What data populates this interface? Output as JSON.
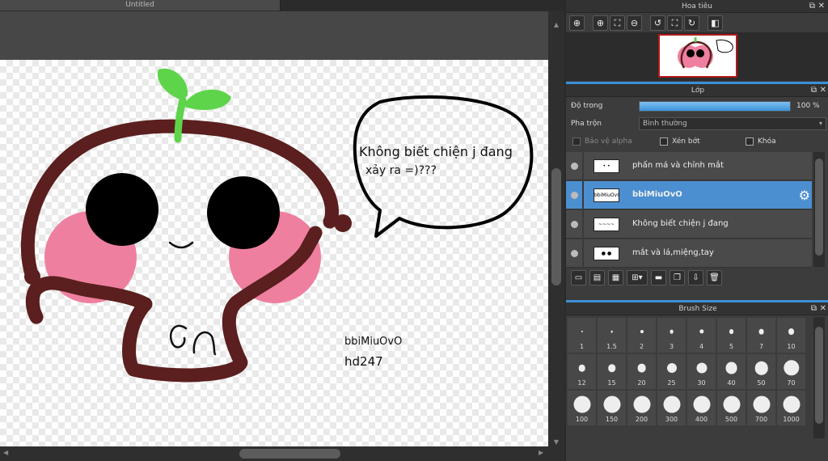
{
  "document": {
    "tab_title": "Untitled"
  },
  "canvas_text": {
    "bubble_line_1": "Không biết chiện j đang",
    "bubble_line_2": "xảy ra =)???",
    "signature_line_1": "bbiMiuOvO",
    "signature_line_2": "hd247"
  },
  "navigator": {
    "title": "Hoa tiêu",
    "buttons": [
      "zoom-reset",
      "zoom-in",
      "fit",
      "zoom-out",
      "rotate-left",
      "fit-window",
      "rotate-right",
      "flip"
    ]
  },
  "layers": {
    "title": "Lớp",
    "opacity_label": "Độ trong",
    "opacity_value": "100 %",
    "opacity_fraction": 1.0,
    "blend_label": "Pha trộn",
    "blend_value": "Bình thường",
    "protect_alpha_label": "Bảo vệ alpha",
    "clipping_label": "Xén bớt",
    "lock_label": "Khóa",
    "items": [
      {
        "name": "phấn má và chỉnh mắt",
        "active": false
      },
      {
        "name": "bbiMiuOvO",
        "active": true,
        "thumb_text": "bbiMiuOvO hd247"
      },
      {
        "name": "Không biết chiện j đang",
        "active": false
      },
      {
        "name": "mắt và lá,miệng,tay",
        "active": false
      }
    ]
  },
  "brush": {
    "title": "Brush Size",
    "sizes": [
      "1",
      "1.5",
      "2",
      "3",
      "4",
      "5",
      "7",
      "10",
      "12",
      "15",
      "20",
      "25",
      "30",
      "40",
      "50",
      "70",
      "100",
      "150",
      "200",
      "300",
      "400",
      "500",
      "700",
      "1000"
    ]
  },
  "colors": {
    "accent": "#4c8fd0",
    "brown": "#5a1f1e",
    "cheek_pink": "#ee7f9f",
    "leaf_green": "#5ed44a"
  }
}
